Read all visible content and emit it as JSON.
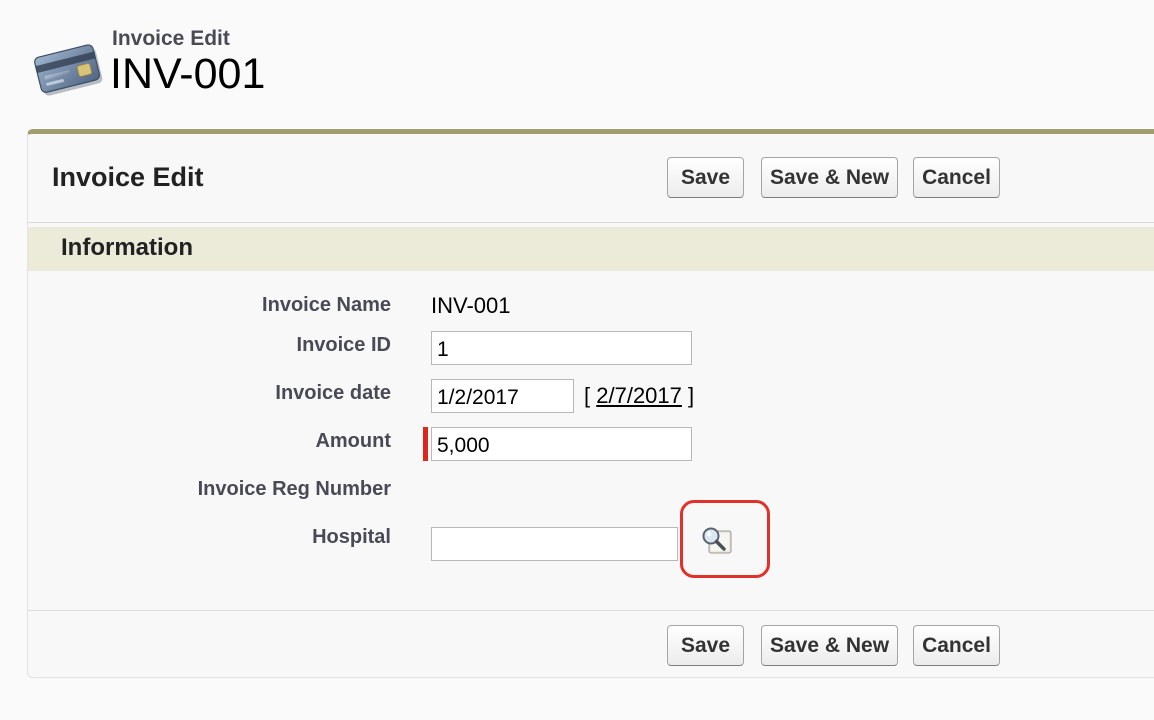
{
  "header": {
    "subtitle": "Invoice Edit",
    "title": "INV-001",
    "icon": "invoice-card-icon"
  },
  "block": {
    "title": "Invoice Edit",
    "buttons": {
      "save": "Save",
      "save_new": "Save & New",
      "cancel": "Cancel"
    }
  },
  "section": {
    "title": "Information"
  },
  "fields": {
    "invoice_name": {
      "label": "Invoice Name",
      "value": "INV-001"
    },
    "invoice_id": {
      "label": "Invoice ID",
      "value": "1"
    },
    "invoice_date": {
      "label": "Invoice date",
      "value": "1/2/2017",
      "bracket_open": "[",
      "today_link": "2/7/2017",
      "bracket_close": "]"
    },
    "amount": {
      "label": "Amount",
      "value": "5,000",
      "required": true
    },
    "invoice_reg_number": {
      "label": "Invoice Reg Number",
      "value": ""
    },
    "hospital": {
      "label": "Hospital",
      "value": "",
      "lookup_icon": "magnifier-lookup-icon"
    }
  },
  "colors": {
    "accent_border": "#a09d6e",
    "section_bg": "#ecebd9",
    "required": "#d9291a",
    "highlight": "#e0322a",
    "label": "#4a4a56"
  }
}
